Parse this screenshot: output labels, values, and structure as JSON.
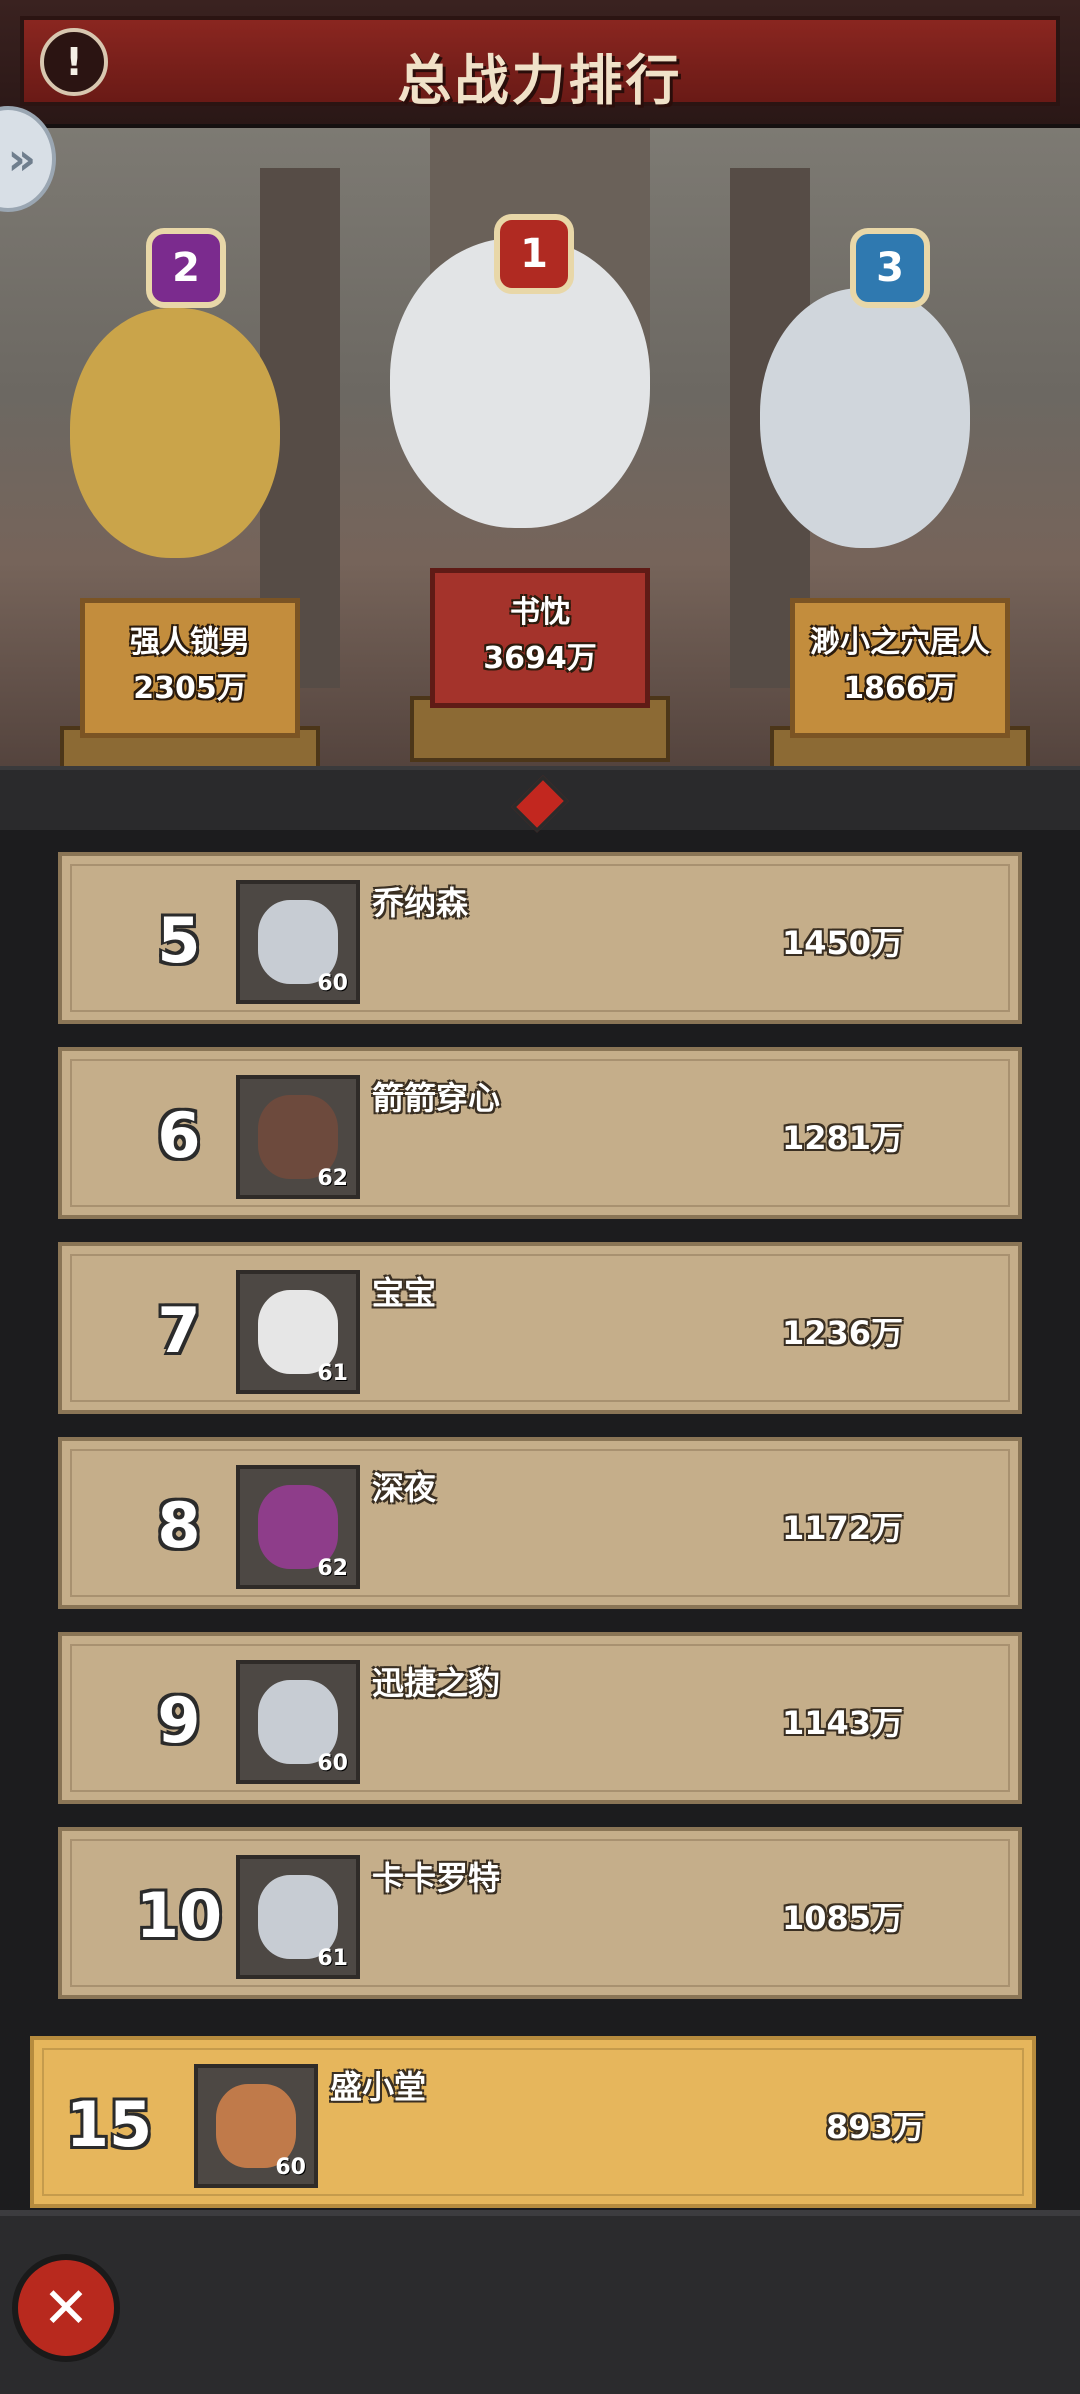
{
  "header": {
    "title": "总战力排行"
  },
  "podium": [
    {
      "rank": "2",
      "name": "强人锁男",
      "power": "2305万"
    },
    {
      "rank": "1",
      "name": "书忱",
      "power": "3694万"
    },
    {
      "rank": "3",
      "name": "渺小之穴居人",
      "power": "1866万"
    }
  ],
  "list": [
    {
      "rank": "5",
      "name": "乔纳森",
      "level": "60",
      "power": "1450万"
    },
    {
      "rank": "6",
      "name": "箭箭穿心",
      "level": "62",
      "power": "1281万"
    },
    {
      "rank": "7",
      "name": "宝宝",
      "level": "61",
      "power": "1236万"
    },
    {
      "rank": "8",
      "name": "深夜",
      "level": "62",
      "power": "1172万"
    },
    {
      "rank": "9",
      "name": "迅捷之豹",
      "level": "60",
      "power": "1143万"
    },
    {
      "rank": "10",
      "name": "卡卡罗特",
      "level": "61",
      "power": "1085万"
    }
  ],
  "me": {
    "rank": "15",
    "name": "盛小堂",
    "level": "60",
    "power": "893万"
  },
  "icons": {
    "info": "!",
    "expand": "»",
    "close": "✕"
  }
}
